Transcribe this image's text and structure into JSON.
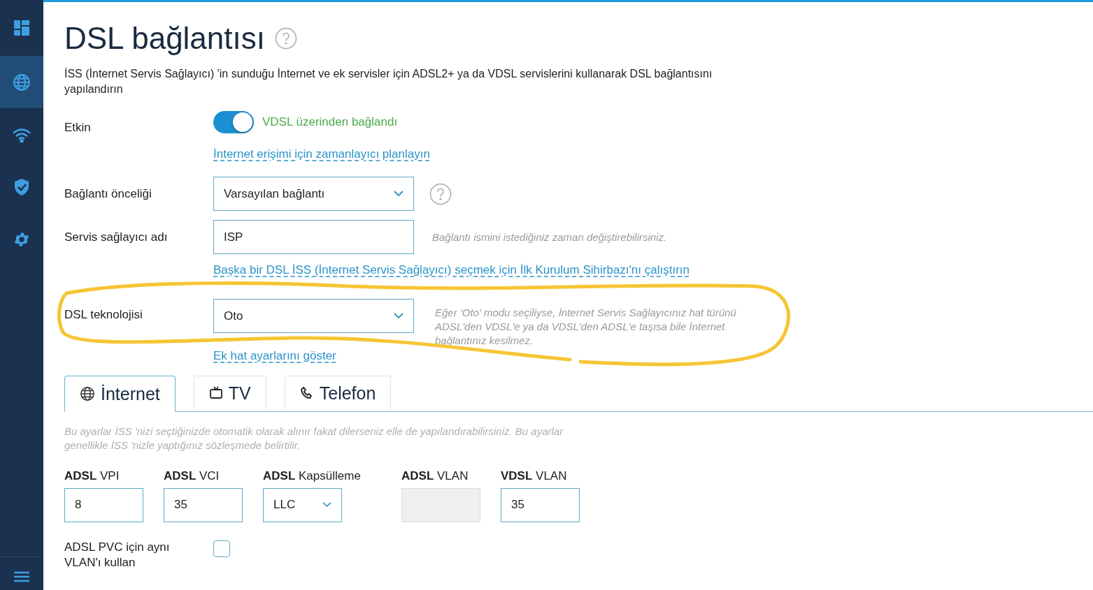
{
  "sidebar": {
    "items": [
      {
        "kind": "dashboard",
        "selected": false
      },
      {
        "kind": "globe",
        "selected": true
      },
      {
        "kind": "wifi",
        "selected": false
      },
      {
        "kind": "shield",
        "selected": false
      },
      {
        "kind": "gear",
        "selected": false
      }
    ]
  },
  "title": "DSL bağlantısı",
  "description": "İSS (İnternet Servis Sağlayıcı) 'in sunduğu İnternet ve ek servisler için ADSL2+ ya da VDSL servislerini kullanarak DSL bağlantısını yapılandırın",
  "enabled": {
    "label": "Etkin",
    "on": true,
    "status": "VDSL üzerinden bağlandı",
    "link": "İnternet erişimi için zamanlayıcı planlayın"
  },
  "priority": {
    "label": "Bağlantı önceliği",
    "value": "Varsayılan bağlantı"
  },
  "provider": {
    "label": "Servis sağlayıcı adı",
    "value": "ISP",
    "hint": "Bağlantı ismini istediğiniz zaman değiştirebilirsiniz.",
    "link": "Başka bir DSL İSS (İnternet Servis Sağlayıcı) seçmek için İlk Kurulum Sihirbazı'nı çalıştırın"
  },
  "dsl_technology": {
    "label": "DSL teknolojisi",
    "value": "Oto",
    "hint": "Eğer 'Oto' modu seçiliyse, İnternet Servis Sağlayıcınız hat türünü ADSL'den VDSL'e ya da VDSL'den ADSL'e taşısa bile İnternet bağlantınız kesilmez.",
    "link": "Ek hat ayarlarını göster"
  },
  "tabs": [
    {
      "label": "İnternet",
      "kind": "globe",
      "selected": true
    },
    {
      "label": "TV",
      "kind": "tv",
      "selected": false
    },
    {
      "label": "Telefon",
      "kind": "phone",
      "selected": false
    }
  ],
  "tab_note": "Bu ayarlar İSS 'nizi seçtiğinizde otomatik olarak alınır fakat dilerseniz elle de yapılandırabilirsiniz. Bu ayarlar genellikle İSS 'nizle yaptığınız sözleşmede belirtilir.",
  "fields": [
    {
      "label": "**ADSL** VPI",
      "kind": "input",
      "value": "8",
      "disabled": false
    },
    {
      "label": "**ADSL** VCI",
      "kind": "input",
      "value": "35",
      "disabled": false
    },
    {
      "label": "**ADSL** Kapsülleme",
      "kind": "select",
      "value": "LLC",
      "disabled": false
    },
    {
      "label": "**ADSL** VLAN",
      "kind": "input",
      "disabled": true
    },
    {
      "label": "**VDSL** VLAN",
      "kind": "input",
      "value": "35",
      "disabled": false
    }
  ],
  "same_vlan": {
    "label": "ADSL PVC için aynı VLAN'ı kullan",
    "checked": false
  }
}
